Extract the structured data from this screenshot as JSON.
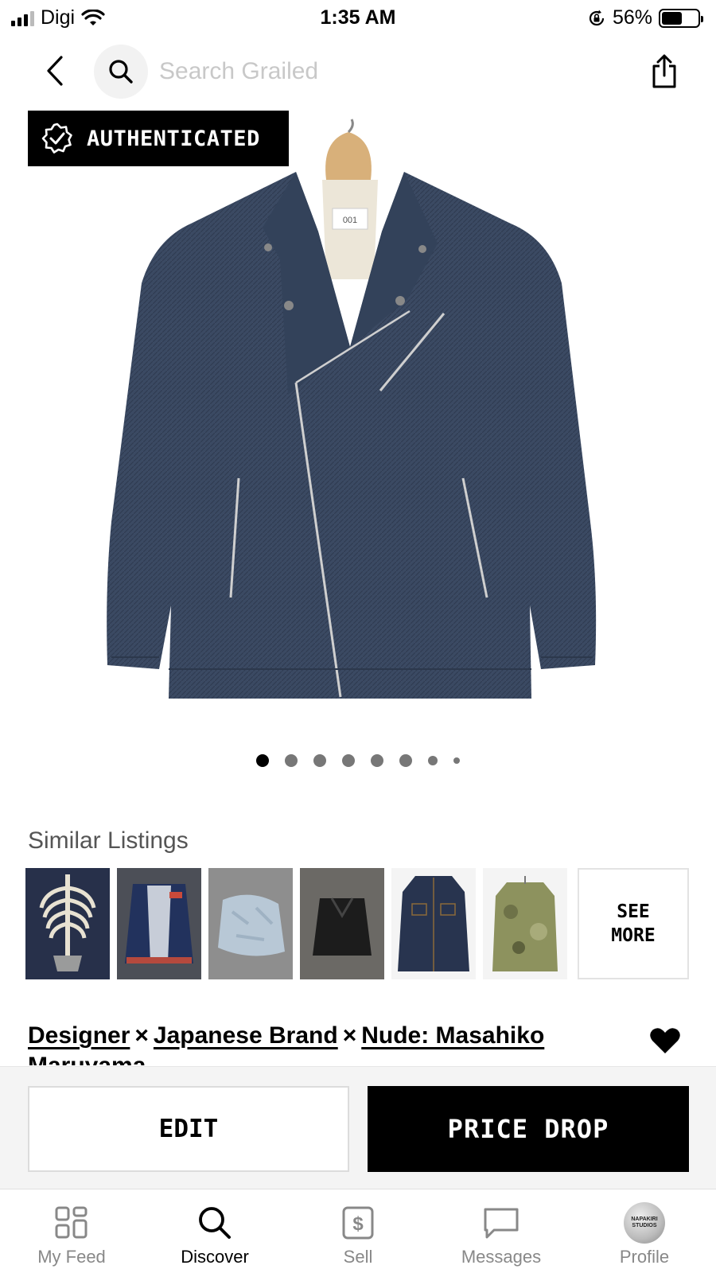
{
  "status_bar": {
    "carrier": "Digi",
    "time": "1:35 AM",
    "battery": "56%",
    "battery_level": 0.56
  },
  "header": {
    "search_placeholder": "Search Grailed"
  },
  "product": {
    "badge": "AUTHENTICATED",
    "image_label": "001",
    "carousel": {
      "total": 8,
      "active_index": 0
    }
  },
  "similar": {
    "title": "Similar Listings",
    "see_more": "SEE\nMORE",
    "thumbnails": [
      {
        "name": "skeleton-denim-jacket",
        "bg": "#2a3348",
        "fg": "#e8e2d2"
      },
      {
        "name": "navy-track-jacket",
        "bg": "#4a4d55",
        "fg": "#1f2e55"
      },
      {
        "name": "bleached-denim-jacket",
        "bg": "#8f8f8f",
        "fg": "#b9c9d4"
      },
      {
        "name": "black-rider-jacket",
        "bg": "#6c6a66",
        "fg": "#1b1b1b"
      },
      {
        "name": "dark-denim-trucker",
        "bg": "#f5f5f5",
        "fg": "#27334f"
      },
      {
        "name": "camo-jacket",
        "bg": "#f5f5f5",
        "fg": "#8b8f5c"
      }
    ]
  },
  "listing": {
    "brands": [
      "Designer",
      "Japanese Brand",
      "Nude: Masahiko Maruyama"
    ],
    "separator": "×"
  },
  "actions": {
    "edit": "EDIT",
    "price_drop": "PRICE DROP"
  },
  "tabs": [
    {
      "label": "My Feed",
      "icon": "grid-icon"
    },
    {
      "label": "Discover",
      "icon": "search-icon",
      "active": true
    },
    {
      "label": "Sell",
      "icon": "dollar-tag-icon"
    },
    {
      "label": "Messages",
      "icon": "chat-icon"
    },
    {
      "label": "Profile",
      "icon": "avatar",
      "avatar_text": "NAPAKIRI\nSTUDIOS"
    }
  ]
}
